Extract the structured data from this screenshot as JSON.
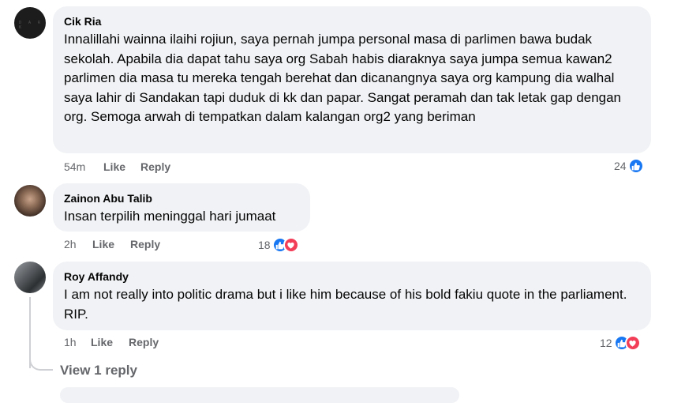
{
  "comments": [
    {
      "author": "Cik Ria",
      "text": "Innalillahi wainna ilaihi rojiun, saya pernah jumpa personal masa di parlimen bawa budak sekolah. Apabila dia dapat tahu saya org Sabah habis diaraknya saya jumpa semua kawan2 parlimen dia masa tu mereka tengah berehat dan dicanangnya saya org kampung dia walhal saya lahir di Sandakan tapi duduk di kk dan papar. Sangat peramah dan tak letak gap dengan org. Semoga arwah di tempatkan dalam kalangan org2 yang beriman",
      "time": "54m",
      "like_label": "Like",
      "reply_label": "Reply",
      "reaction_count": "24",
      "reactions": [
        "like-icon"
      ]
    },
    {
      "author": "Zainon Abu Talib",
      "text": "Insan terpilih meninggal hari jumaat",
      "time": "2h",
      "like_label": "Like",
      "reply_label": "Reply",
      "reaction_count": "18",
      "reactions": [
        "like-icon",
        "love-icon"
      ]
    },
    {
      "author": "Roy Affandy",
      "text": "I am not really into politic drama but i like him because of his bold fakiu quote in the parliament. RIP.",
      "time": "1h",
      "like_label": "Like",
      "reply_label": "Reply",
      "reaction_count": "12",
      "reactions": [
        "like-icon",
        "love-icon"
      ]
    }
  ],
  "view_replies_label": "View 1 reply",
  "colors": {
    "bubble": "#f0f2f5",
    "meta_text": "#65676b",
    "like_blue": "#1877f2",
    "love_red": "#f33e58"
  }
}
